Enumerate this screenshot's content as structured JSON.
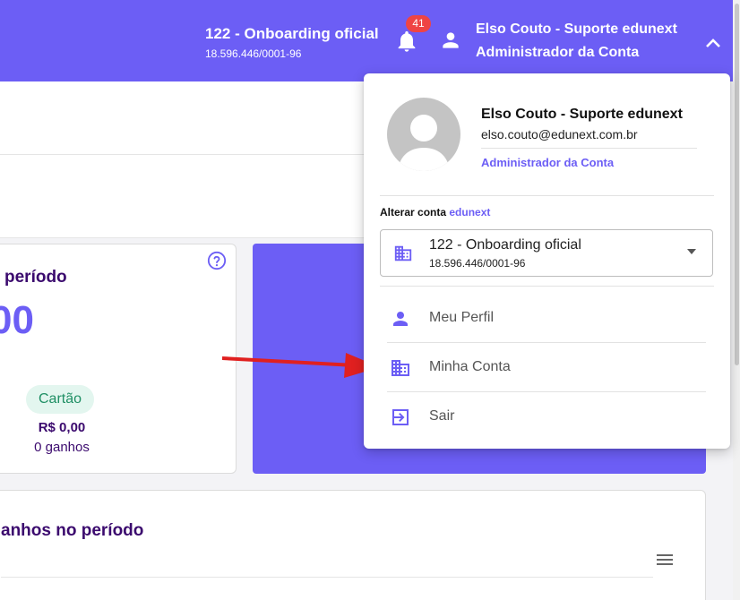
{
  "header": {
    "org_name": "122 - Onboarding oficial",
    "org_cnpj": "18.596.446/0001-96",
    "notifications_count": "41",
    "user_name": "Elso Couto - Suporte edunext",
    "user_role": "Administrador da Conta",
    "icons": {
      "bell": "bell-icon",
      "user": "user-icon",
      "chevron": "chevron-up-icon"
    }
  },
  "background": {
    "card_period_title": "período",
    "card_period_value": "00",
    "chip_label": "Cartão",
    "chip_amount": "R$ 0,00",
    "chip_count": "0 ganhos",
    "earnings_title": "anhos no período"
  },
  "dropdown": {
    "name": "Elso Couto - Suporte edunext",
    "email": "elso.couto@edunext.com.br",
    "role": "Administrador da Conta",
    "switch_label": "Alterar conta",
    "switch_brand": "edunext",
    "account_select": {
      "name": "122 - Onboarding oficial",
      "cnpj": "18.596.446/0001-96"
    },
    "menu": [
      {
        "label": "Meu Perfil",
        "icon": "person-icon"
      },
      {
        "label": "Minha Conta",
        "icon": "building-icon"
      },
      {
        "label": "Sair",
        "icon": "logout-icon"
      }
    ]
  },
  "colors": {
    "brand": "#6c5ef5",
    "title_purple": "#3b0a6e",
    "badge_red": "#ef4444",
    "chip_bg": "#e3f6ef",
    "chip_text": "#1f8f64",
    "arrow_red": "#e02020"
  }
}
